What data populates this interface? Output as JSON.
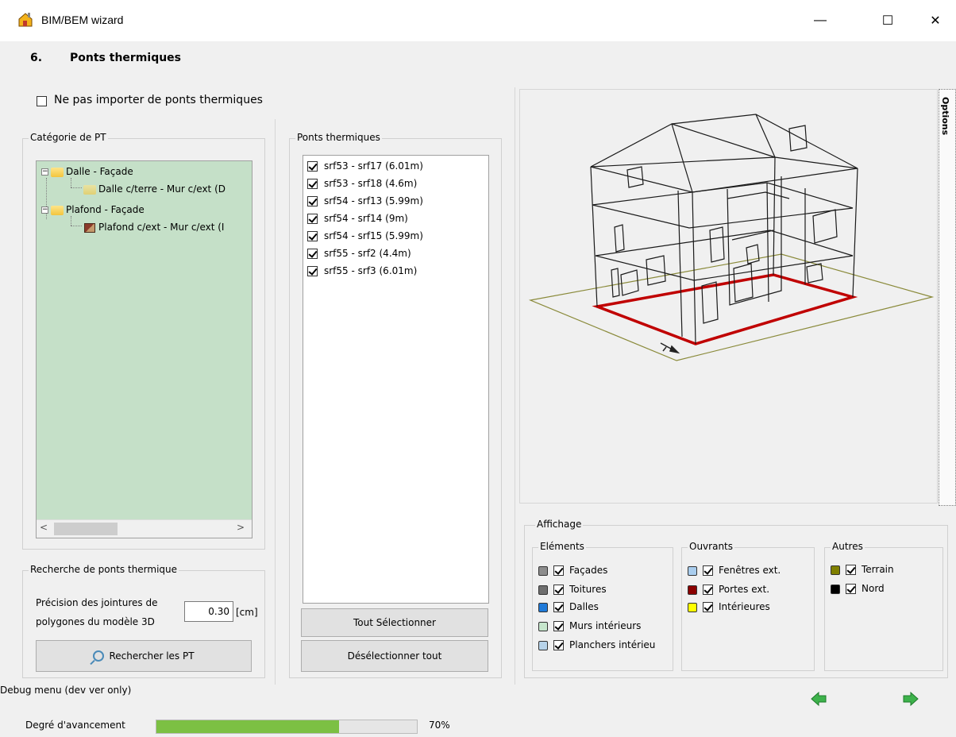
{
  "window": {
    "title": "BIM/BEM wizard",
    "minimize_glyph": "—",
    "maximize_glyph": "☐",
    "close_glyph": "✕"
  },
  "step": {
    "number": "6.",
    "title": "Ponts thermiques"
  },
  "no_import": {
    "label": "Ne pas importer de ponts thermiques",
    "checked": false
  },
  "category": {
    "title": "Catégorie de PT",
    "tree": [
      {
        "label": "Dalle - Façade",
        "level": 0,
        "expanded": true,
        "icon": "folder-icon"
      },
      {
        "label": "Dalle c/terre - Mur c/ext (D",
        "level": 1,
        "icon": "folder-icon"
      },
      {
        "label": "Plafond - Façade",
        "level": 0,
        "expanded": true,
        "icon": "folder-icon"
      },
      {
        "label": "Plafond c/ext - Mur c/ext (I",
        "level": 1,
        "icon": "thermal-bridge-icon"
      }
    ],
    "scroll_left": "<",
    "scroll_right": ">"
  },
  "search": {
    "title": "Recherche de ponts thermique",
    "precision_label_line1": "Précision des jointures de",
    "precision_label_line2": "polygones du modèle 3D",
    "precision_value": "0.30",
    "precision_unit": "[cm]",
    "button_label": "Rechercher les PT"
  },
  "bridges": {
    "title": "Ponts thermiques",
    "items": [
      {
        "label": "srf53 - srf17 (6.01m)",
        "checked": true
      },
      {
        "label": "srf53 - srf18 (4.6m)",
        "checked": true
      },
      {
        "label": "srf54 - srf13 (5.99m)",
        "checked": true
      },
      {
        "label": "srf54 - srf14 (9m)",
        "checked": true
      },
      {
        "label": "srf54 - srf15 (5.99m)",
        "checked": true
      },
      {
        "label": "srf55 - srf2 (4.4m)",
        "checked": true
      },
      {
        "label": "srf55 - srf3 (6.01m)",
        "checked": true
      }
    ],
    "select_all_label": "Tout Sélectionner",
    "deselect_all_label": "Désélectionner tout"
  },
  "viewer": {
    "options_tab": "Options",
    "highlight_color": "#c00000",
    "terrain_color": "#8a8a3a"
  },
  "display": {
    "title": "Affichage",
    "elements": {
      "title": "Eléments",
      "items": [
        {
          "label": "Façades",
          "color": "#8c8c8c",
          "checked": true
        },
        {
          "label": "Toitures",
          "color": "#6e6e6e",
          "checked": true
        },
        {
          "label": "Dalles",
          "color": "#1f7ad8",
          "checked": true
        },
        {
          "label": "Murs intérieurs",
          "color": "#c6e6cc",
          "checked": true
        },
        {
          "label": "Planchers intérieu",
          "color": "#b7d3ea",
          "checked": true
        }
      ]
    },
    "openings": {
      "title": "Ouvrants",
      "items": [
        {
          "label": "Fenêtres ext.",
          "color": "#a9cdee",
          "checked": true
        },
        {
          "label": "Portes ext.",
          "color": "#8b0000",
          "checked": true
        },
        {
          "label": "Intérieures",
          "color": "#ffff00",
          "checked": true
        }
      ]
    },
    "others": {
      "title": "Autres",
      "items": [
        {
          "label": "Terrain",
          "color": "#808000",
          "checked": true
        },
        {
          "label": "Nord",
          "color": "#000000",
          "checked": true
        }
      ]
    }
  },
  "footer": {
    "debug_label": "Debug menu (dev ver only)",
    "progress_label": "Degré d'avancement",
    "progress_value": 0.7,
    "progress_text": "70%",
    "nav_color": "#3db24b"
  }
}
